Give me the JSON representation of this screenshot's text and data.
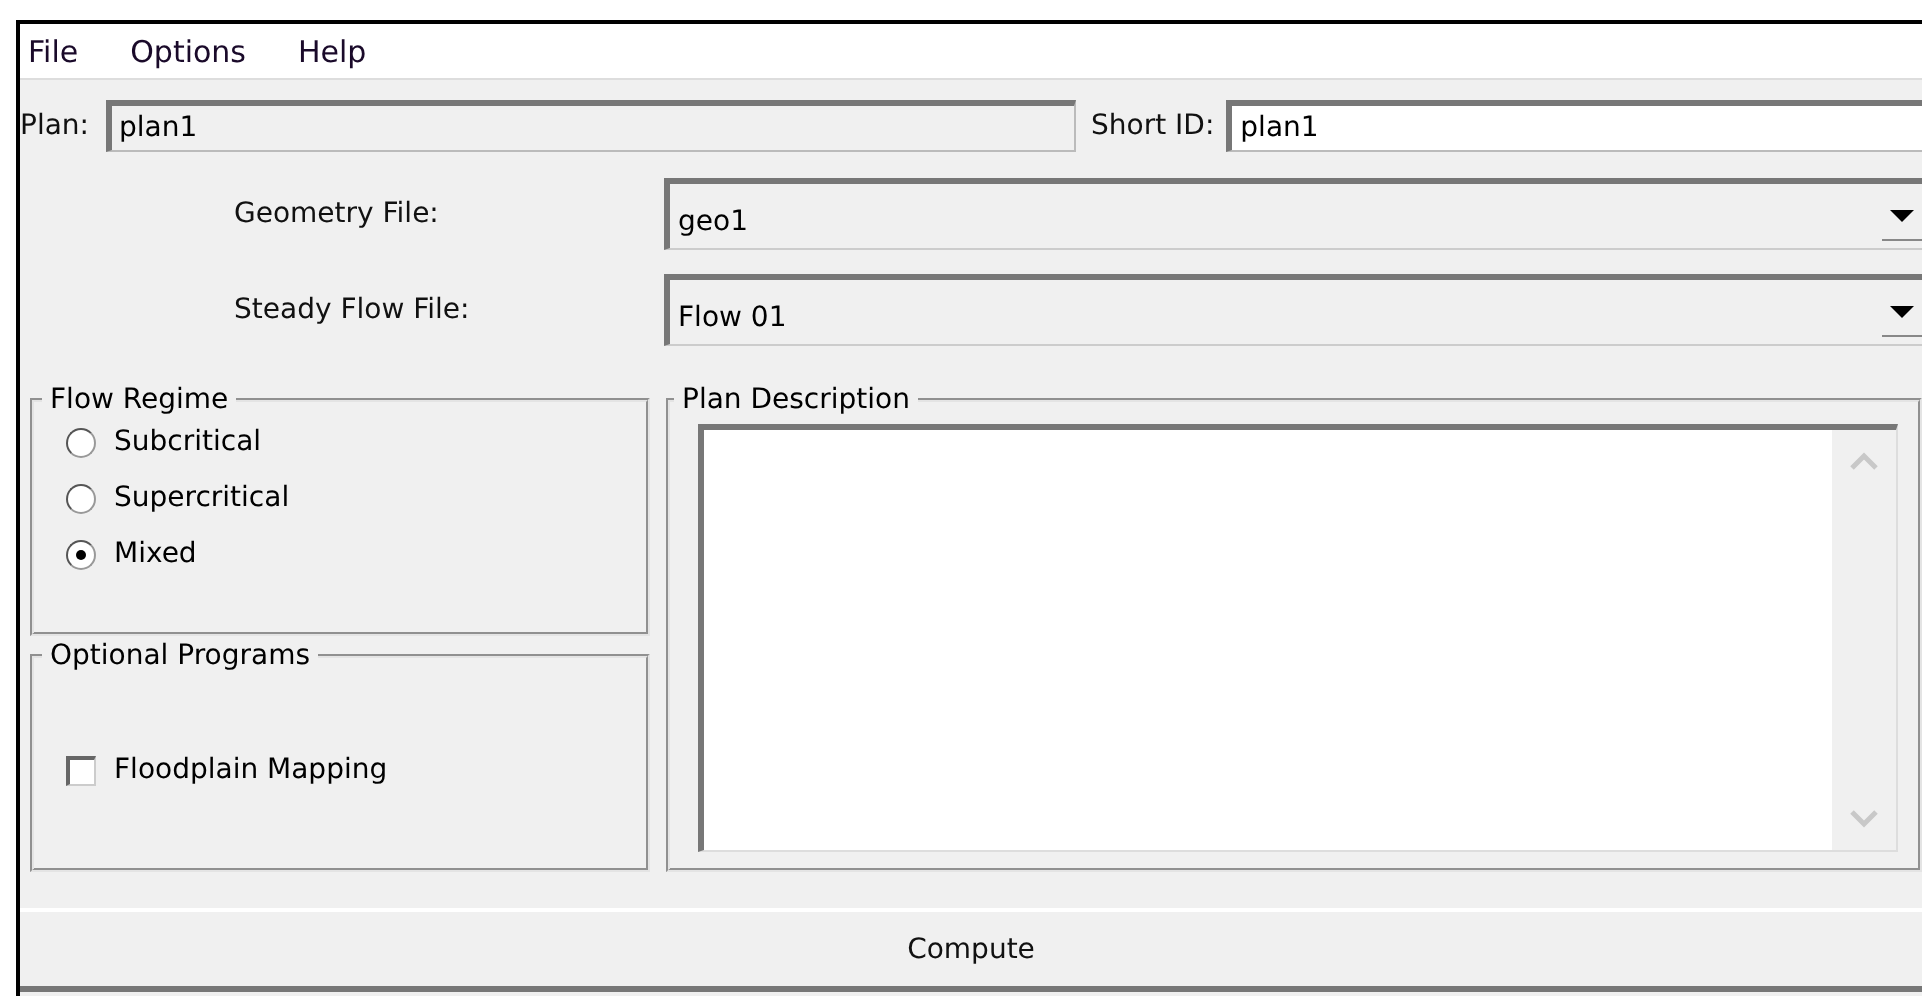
{
  "menu": [
    "File",
    "Options",
    "Help"
  ],
  "plan": {
    "label": "Plan:",
    "value": "plan1"
  },
  "short_id": {
    "label": "Short ID:",
    "value": "plan1"
  },
  "files": [
    {
      "label": "Geometry File:",
      "value": "geo1"
    },
    {
      "label": "Steady Flow File:",
      "value": "Flow 01"
    }
  ],
  "flow_regime": {
    "title": "Flow Regime",
    "options": [
      {
        "label": "Subcritical",
        "selected": false
      },
      {
        "label": "Supercritical",
        "selected": false
      },
      {
        "label": "Mixed",
        "selected": true
      }
    ]
  },
  "optional_programs": {
    "title": "Optional Programs",
    "items": [
      {
        "label": "Floodplain Mapping",
        "checked": false
      }
    ]
  },
  "plan_description": {
    "title": "Plan Description"
  },
  "compute_button": "Compute"
}
